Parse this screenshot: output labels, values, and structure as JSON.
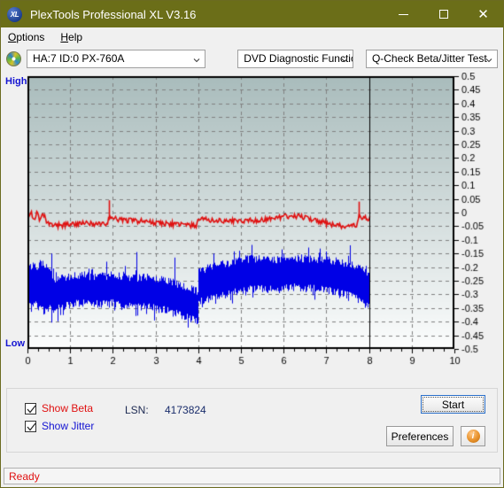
{
  "window": {
    "title": "PlexTools Professional XL V3.16",
    "app_icon": "xl-logo-icon",
    "minimize_label": "–",
    "maximize_label": "□",
    "close_label": "✕"
  },
  "menubar": {
    "items": [
      {
        "label": "Options",
        "accel": "O"
      },
      {
        "label": "Help",
        "accel": "H"
      }
    ]
  },
  "toolbar": {
    "drive_icon": "optical-disc-icon",
    "drive_select": {
      "value": "HA:7 ID:0  PX-760A",
      "options": [
        "HA:7 ID:0  PX-760A"
      ]
    },
    "function_select": {
      "value": "DVD Diagnostic Functions",
      "options": [
        "DVD Diagnostic Functions"
      ]
    },
    "test_select": {
      "value": "Q-Check Beta/Jitter Test",
      "options": [
        "Q-Check Beta/Jitter Test"
      ]
    }
  },
  "chart_axis": {
    "high_label": "High",
    "low_label": "Low"
  },
  "controls": {
    "show_beta": {
      "label": "Show Beta",
      "checked": true,
      "color": "#e01010"
    },
    "show_jitter": {
      "label": "Show Jitter",
      "checked": true,
      "color": "#1414d2"
    },
    "lsn_label": "LSN:",
    "lsn_value": "4173824",
    "start_button": "Start",
    "preferences_button": "Preferences",
    "info_button": "i"
  },
  "statusbar": {
    "text": "Ready"
  },
  "chart_data": {
    "type": "line",
    "title": "Q-Check Beta/Jitter Test",
    "xlabel": "",
    "ylabel": "",
    "xlim": [
      0,
      10
    ],
    "ylim": [
      -0.5,
      0.5
    ],
    "xticks": [
      0,
      1,
      2,
      3,
      4,
      5,
      6,
      7,
      8,
      9,
      10
    ],
    "xtick_labels": [
      "0",
      "1",
      "2",
      "3",
      "4",
      "5",
      "6",
      "7",
      "8",
      "9",
      "10"
    ],
    "yticks": [
      0.5,
      0.45,
      0.4,
      0.35,
      0.3,
      0.25,
      0.2,
      0.15,
      0.1,
      0.05,
      0,
      -0.05,
      -0.1,
      -0.15,
      -0.2,
      -0.25,
      -0.3,
      -0.35,
      -0.4,
      -0.45,
      -0.5
    ],
    "ytick_labels": [
      "0.5",
      "0.45",
      "0.4",
      "0.35",
      "0.3",
      "0.25",
      "0.2",
      "0.15",
      "0.1",
      "0.05",
      "0",
      "-0.05",
      "-0.1",
      "-0.15",
      "-0.2",
      "-0.25",
      "-0.3",
      "-0.35",
      "-0.4",
      "-0.45",
      "-0.5"
    ],
    "grid": true,
    "grid_style": "dashed",
    "grid_color": "#808080",
    "background_gradient": [
      "#a9bcbc",
      "#fcfdfd"
    ],
    "data_end_marker_x": 8.0,
    "legend": [
      {
        "name": "Beta",
        "color": "#e01010"
      },
      {
        "name": "Jitter",
        "color": "#0000e6"
      }
    ],
    "series": [
      {
        "name": "Beta",
        "color": "#e01010",
        "type": "line",
        "x_range": [
          0,
          8
        ],
        "noise": 0.008,
        "spikes": [
          {
            "x": 1.9,
            "y": 0.045
          },
          {
            "x": 7.75,
            "y": 0.04
          }
        ],
        "control_points": [
          [
            0.0,
            -0.012
          ],
          [
            0.08,
            0.005
          ],
          [
            0.14,
            -0.03
          ],
          [
            0.22,
            0.0
          ],
          [
            0.28,
            -0.035
          ],
          [
            0.36,
            -0.005
          ],
          [
            0.45,
            -0.04
          ],
          [
            0.6,
            -0.048
          ],
          [
            0.8,
            -0.046
          ],
          [
            1.0,
            -0.042
          ],
          [
            1.3,
            -0.04
          ],
          [
            1.6,
            -0.041
          ],
          [
            1.85,
            -0.043
          ],
          [
            1.91,
            -0.016
          ],
          [
            2.0,
            -0.022
          ],
          [
            2.3,
            -0.028
          ],
          [
            2.7,
            -0.032
          ],
          [
            3.05,
            -0.038
          ],
          [
            3.4,
            -0.042
          ],
          [
            3.7,
            -0.046
          ],
          [
            3.95,
            -0.048
          ],
          [
            4.0,
            -0.022
          ],
          [
            4.25,
            -0.028
          ],
          [
            4.6,
            -0.03
          ],
          [
            5.0,
            -0.03
          ],
          [
            5.4,
            -0.028
          ],
          [
            5.8,
            -0.02
          ],
          [
            6.05,
            -0.014
          ],
          [
            6.25,
            -0.012
          ],
          [
            6.5,
            -0.018
          ],
          [
            6.8,
            -0.03
          ],
          [
            7.1,
            -0.044
          ],
          [
            7.4,
            -0.05
          ],
          [
            7.7,
            -0.05
          ],
          [
            7.76,
            -0.014
          ],
          [
            7.85,
            -0.02
          ],
          [
            8.0,
            -0.022
          ]
        ]
      },
      {
        "name": "Jitter",
        "color": "#0000e6",
        "type": "band",
        "x_range": [
          0,
          8
        ],
        "band": [
          [
            0.0,
            -0.2,
            -0.33
          ],
          [
            0.1,
            -0.195,
            -0.345
          ],
          [
            0.2,
            -0.205,
            -0.33
          ],
          [
            0.3,
            -0.185,
            -0.355
          ],
          [
            0.4,
            -0.2,
            -0.36
          ],
          [
            0.5,
            -0.215,
            -0.35
          ],
          [
            0.6,
            -0.245,
            -0.355
          ],
          [
            0.7,
            -0.25,
            -0.35
          ],
          [
            0.8,
            -0.24,
            -0.345
          ],
          [
            1.0,
            -0.235,
            -0.335
          ],
          [
            1.2,
            -0.23,
            -0.33
          ],
          [
            1.5,
            -0.235,
            -0.335
          ],
          [
            1.8,
            -0.235,
            -0.335
          ],
          [
            2.0,
            -0.23,
            -0.33
          ],
          [
            2.2,
            -0.235,
            -0.335
          ],
          [
            2.5,
            -0.24,
            -0.34
          ],
          [
            2.8,
            -0.24,
            -0.345
          ],
          [
            3.0,
            -0.245,
            -0.35
          ],
          [
            3.2,
            -0.25,
            -0.355
          ],
          [
            3.4,
            -0.258,
            -0.365
          ],
          [
            3.6,
            -0.268,
            -0.375
          ],
          [
            3.8,
            -0.28,
            -0.385
          ],
          [
            3.95,
            -0.29,
            -0.395
          ],
          [
            3.99,
            -0.295,
            -0.4
          ],
          [
            4.0,
            -0.205,
            -0.32
          ],
          [
            4.1,
            -0.21,
            -0.32
          ],
          [
            4.3,
            -0.2,
            -0.31
          ],
          [
            4.6,
            -0.19,
            -0.3
          ],
          [
            4.9,
            -0.18,
            -0.29
          ],
          [
            5.1,
            -0.172,
            -0.28
          ],
          [
            5.4,
            -0.17,
            -0.275
          ],
          [
            5.7,
            -0.178,
            -0.282
          ],
          [
            6.0,
            -0.17,
            -0.275
          ],
          [
            6.3,
            -0.168,
            -0.272
          ],
          [
            6.6,
            -0.172,
            -0.278
          ],
          [
            6.9,
            -0.175,
            -0.28
          ],
          [
            7.1,
            -0.178,
            -0.285
          ],
          [
            7.3,
            -0.182,
            -0.292
          ],
          [
            7.5,
            -0.19,
            -0.3
          ],
          [
            7.7,
            -0.2,
            -0.315
          ],
          [
            7.85,
            -0.215,
            -0.33
          ],
          [
            8.0,
            -0.225,
            -0.345
          ]
        ],
        "spikes": [
          {
            "x": 0.55,
            "y": -0.15
          },
          {
            "x": 1.85,
            "y": -0.18
          },
          {
            "x": 2.55,
            "y": -0.145
          },
          {
            "x": 3.45,
            "y": -0.165
          },
          {
            "x": 4.35,
            "y": -0.15
          },
          {
            "x": 4.95,
            "y": -0.14
          },
          {
            "x": 5.95,
            "y": -0.135
          },
          {
            "x": 6.85,
            "y": -0.132
          },
          {
            "x": 7.55,
            "y": -0.12
          }
        ]
      }
    ]
  }
}
